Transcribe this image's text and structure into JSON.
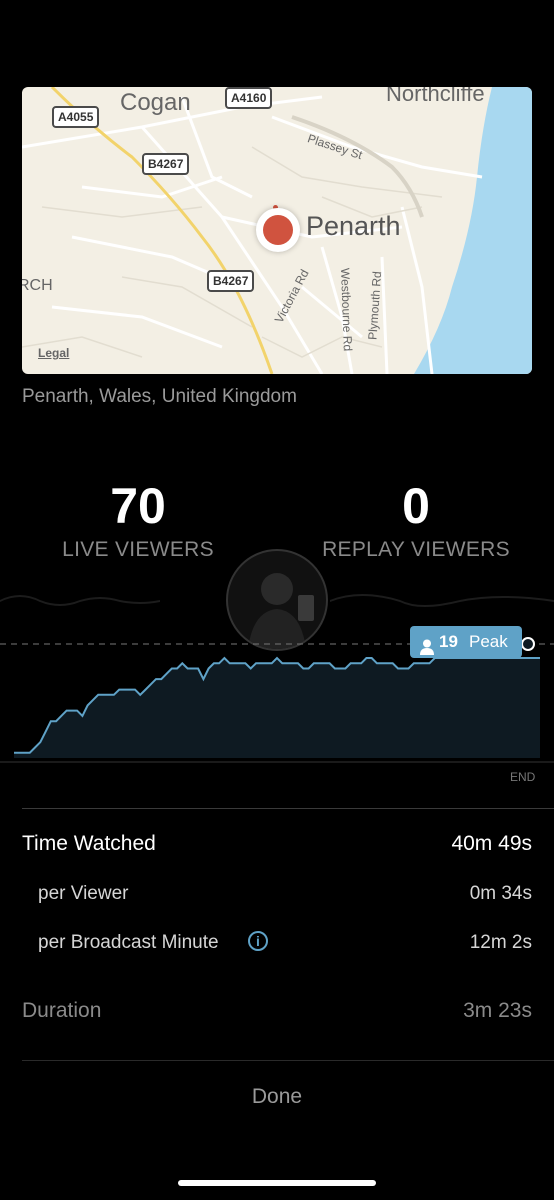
{
  "map": {
    "places": {
      "cogan": "Cogan",
      "northcliffe": "Northcliffe",
      "penarth": "Penarth",
      "rch": "RCH"
    },
    "road_labels": {
      "a4055": "A4055",
      "a4160": "A4160",
      "b4267_top": "B4267",
      "b4267_bottom": "B4267"
    },
    "streets": {
      "plassey": "Plassey St",
      "victoria": "Victoria Rd",
      "westbourne": "Westbourne Rd",
      "plymouth": "Plymouth Rd"
    },
    "legal": "Legal",
    "pin_icon": "location-pin-icon",
    "colors": {
      "land": "#f3efe4",
      "water": "#a8d8f0",
      "pin": "#d0533f"
    }
  },
  "location_text": "Penarth, Wales, United Kingdom",
  "stats": {
    "live": {
      "value": "70",
      "label": "LIVE VIEWERS"
    },
    "replay": {
      "value": "0",
      "label": "REPLAY VIEWERS"
    }
  },
  "chart_data": {
    "type": "area",
    "peak_label": "Peak",
    "peak_value": "19",
    "end_label": "END",
    "peak_icon": "person-icon",
    "values": [
      1,
      1,
      1,
      1,
      2,
      3,
      5,
      7,
      7,
      8,
      9,
      9,
      9,
      8,
      10,
      11,
      12,
      12,
      12,
      12,
      13,
      13,
      13,
      13,
      12,
      13,
      14,
      15,
      15,
      16,
      17,
      17,
      18,
      17,
      17,
      17,
      15,
      17,
      18,
      18,
      19,
      18,
      18,
      18,
      18,
      17,
      18,
      18,
      18,
      18,
      19,
      18,
      18,
      18,
      18,
      17,
      17,
      18,
      18,
      18,
      18,
      17,
      17,
      17,
      18,
      18,
      18,
      19,
      19,
      18,
      18,
      18,
      18,
      17,
      17,
      17,
      18,
      18,
      18,
      18,
      19,
      19,
      19,
      19,
      19,
      19,
      19,
      19,
      19,
      19,
      19,
      19,
      19,
      19,
      19,
      19,
      19,
      19,
      19,
      19,
      19
    ],
    "ylim": [
      0,
      21
    ],
    "colors": {
      "line": "#5fa2c7",
      "fill": "#0e1a22",
      "dashed": "#777777"
    }
  },
  "metrics": {
    "time_watched": {
      "label": "Time Watched",
      "value": "40m 49s"
    },
    "per_viewer": {
      "label": "per Viewer",
      "value": "0m 34s"
    },
    "per_broadcast_minute": {
      "label": "per Broadcast Minute",
      "value": "12m 2s",
      "icon": "info-icon",
      "icon_glyph": "i"
    },
    "duration": {
      "label": "Duration",
      "value": "3m 23s"
    }
  },
  "done_label": "Done"
}
